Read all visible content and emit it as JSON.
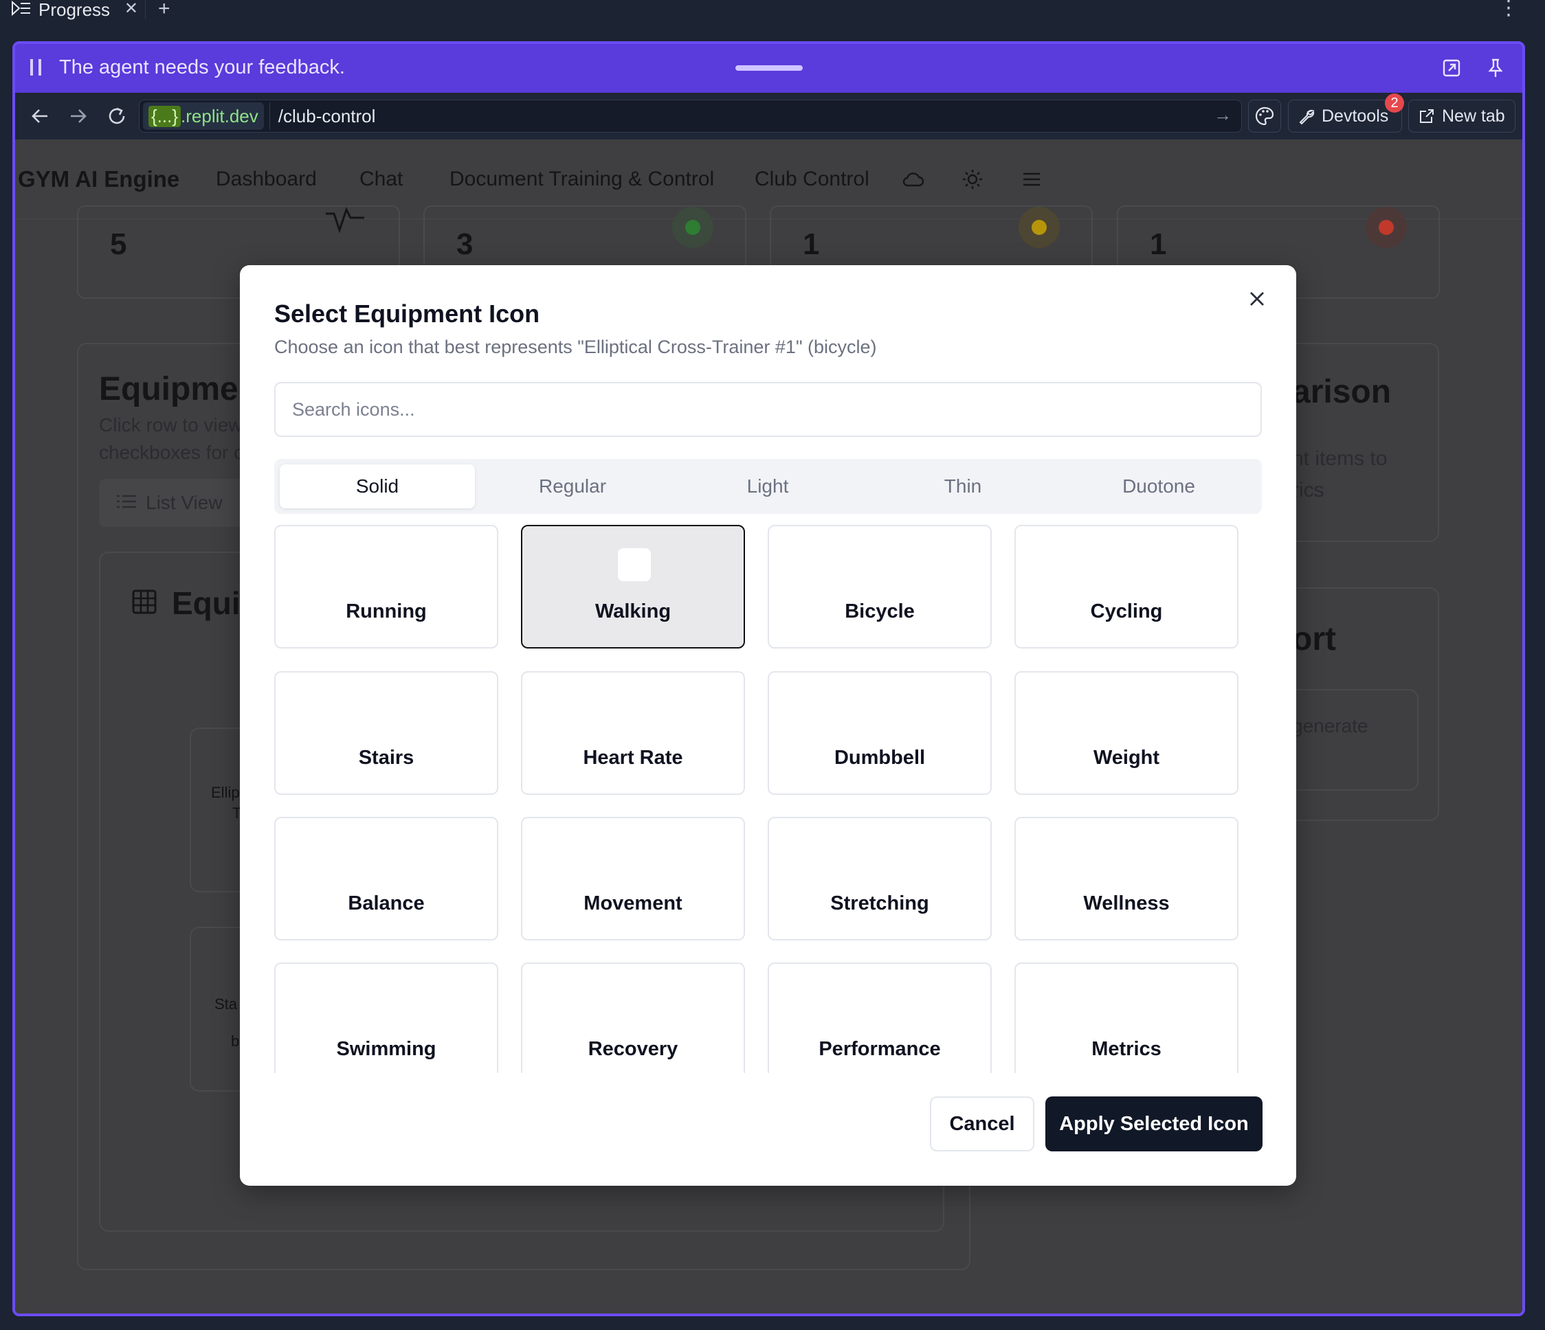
{
  "ide": {
    "tab_label": "Progress",
    "tab_close": "✕",
    "add_tab": "+",
    "menu_glyph": "⋮"
  },
  "agent_bar": {
    "message": "The agent needs your feedback."
  },
  "browser": {
    "url_domain_prefix": "{...}",
    "url_domain_suffix": ".replit.dev",
    "url_path": "/club-control",
    "devtools_label": "Devtools",
    "devtools_badge": "2",
    "new_tab_label": "New tab"
  },
  "app": {
    "brand": "GYM AI Engine",
    "nav": [
      "Dashboard",
      "Chat",
      "Document Training & Control",
      "Club Control"
    ],
    "stats": [
      "5",
      "3",
      "1",
      "1"
    ],
    "status_colors": [
      "#2e7d32",
      "#b7950b",
      "#c0392b"
    ],
    "bg_fragments": {
      "equipment_title": "Equipmen",
      "equipment_desc_1": "Click row to view",
      "equipment_desc_2": "checkboxes for c",
      "list_view": "List View",
      "equip_sub": "Equip",
      "row_1a": "Ellip",
      "row_1b": "T",
      "row_2": "Sta",
      "row_2b": "b",
      "comparison_title": "arison",
      "comparison_desc_1": "nt items to",
      "comparison_desc_2": "rics",
      "report_title": "ort",
      "report_desc": "generate"
    }
  },
  "modal": {
    "title": "Select Equipment Icon",
    "description": "Choose an icon that best represents \"Elliptical Cross-Trainer #1\" (bicycle)",
    "search_placeholder": "Search icons...",
    "tabs": [
      {
        "label": "Solid",
        "active": true
      },
      {
        "label": "Regular",
        "active": false
      },
      {
        "label": "Light",
        "active": false
      },
      {
        "label": "Thin",
        "active": false
      },
      {
        "label": "Duotone",
        "active": false
      }
    ],
    "icons": [
      "Running",
      "Walking",
      "Bicycle",
      "Cycling",
      "Stairs",
      "Heart Rate",
      "Dumbbell",
      "Weight",
      "Balance",
      "Movement",
      "Stretching",
      "Wellness",
      "Swimming",
      "Recovery",
      "Performance",
      "Metrics"
    ],
    "selected_icon": "Walking",
    "cancel_label": "Cancel",
    "apply_label": "Apply Selected Icon"
  }
}
